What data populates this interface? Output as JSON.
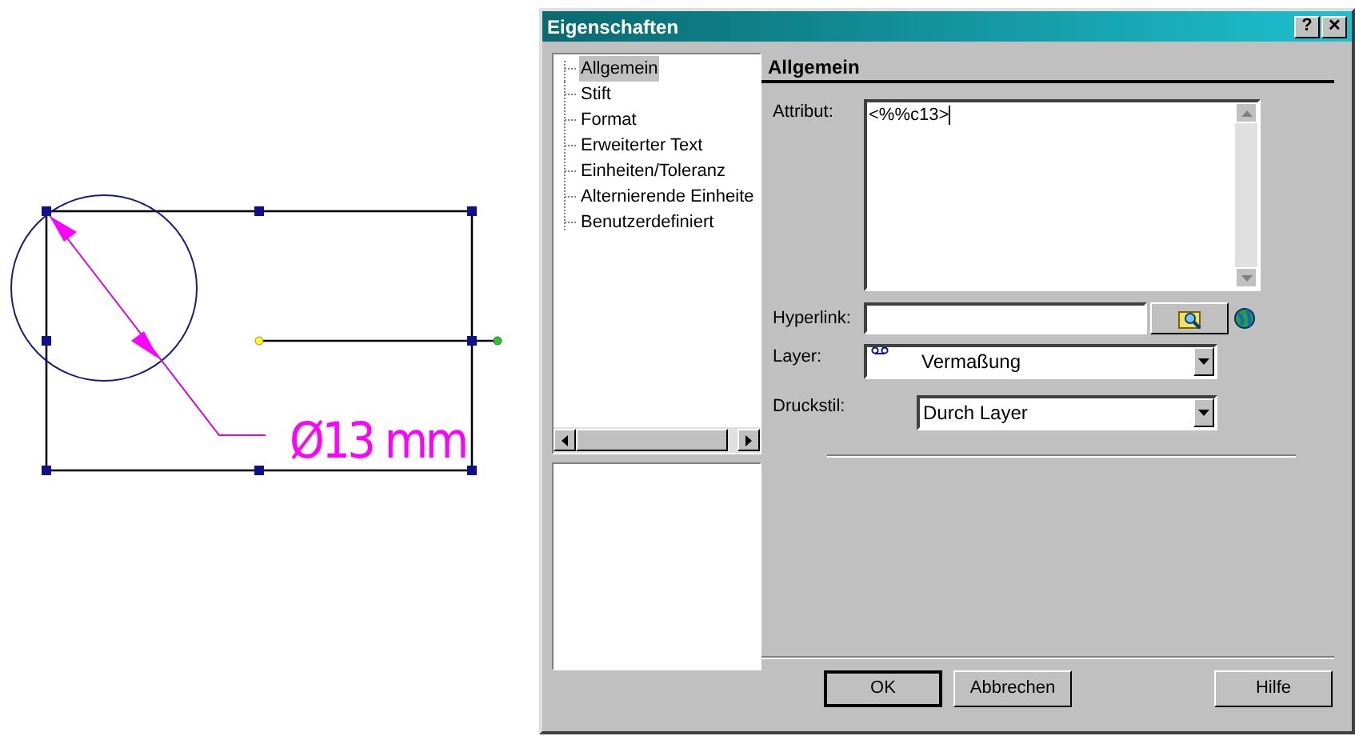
{
  "drawing": {
    "dimension_text": "Ø13 mm"
  },
  "dialog": {
    "title": "Eigenschaften",
    "help_button": "?",
    "close_button": "✕",
    "tree": [
      {
        "label": "Allgemein",
        "selected": true
      },
      {
        "label": "Stift",
        "selected": false
      },
      {
        "label": "Format",
        "selected": false
      },
      {
        "label": "Erweiterter Text",
        "selected": false
      },
      {
        "label": "Einheiten/Toleranz",
        "selected": false
      },
      {
        "label": "Alternierende Einheite",
        "selected": false
      },
      {
        "label": "Benutzerdefiniert",
        "selected": false
      }
    ],
    "section_title": "Allgemein",
    "attribut": {
      "label": "Attribut:",
      "value": "<%%c13>"
    },
    "hyperlink": {
      "label": "Hyperlink:"
    },
    "layer": {
      "label": "Layer:",
      "value": "Vermaßung"
    },
    "druckstil": {
      "label": "Druckstil:",
      "value": "Durch Layer"
    },
    "buttons": [
      {
        "label": "OK",
        "default": true
      },
      {
        "label": "Abbrechen",
        "default": false
      },
      {
        "label": "Hilfe",
        "default": false
      }
    ]
  }
}
